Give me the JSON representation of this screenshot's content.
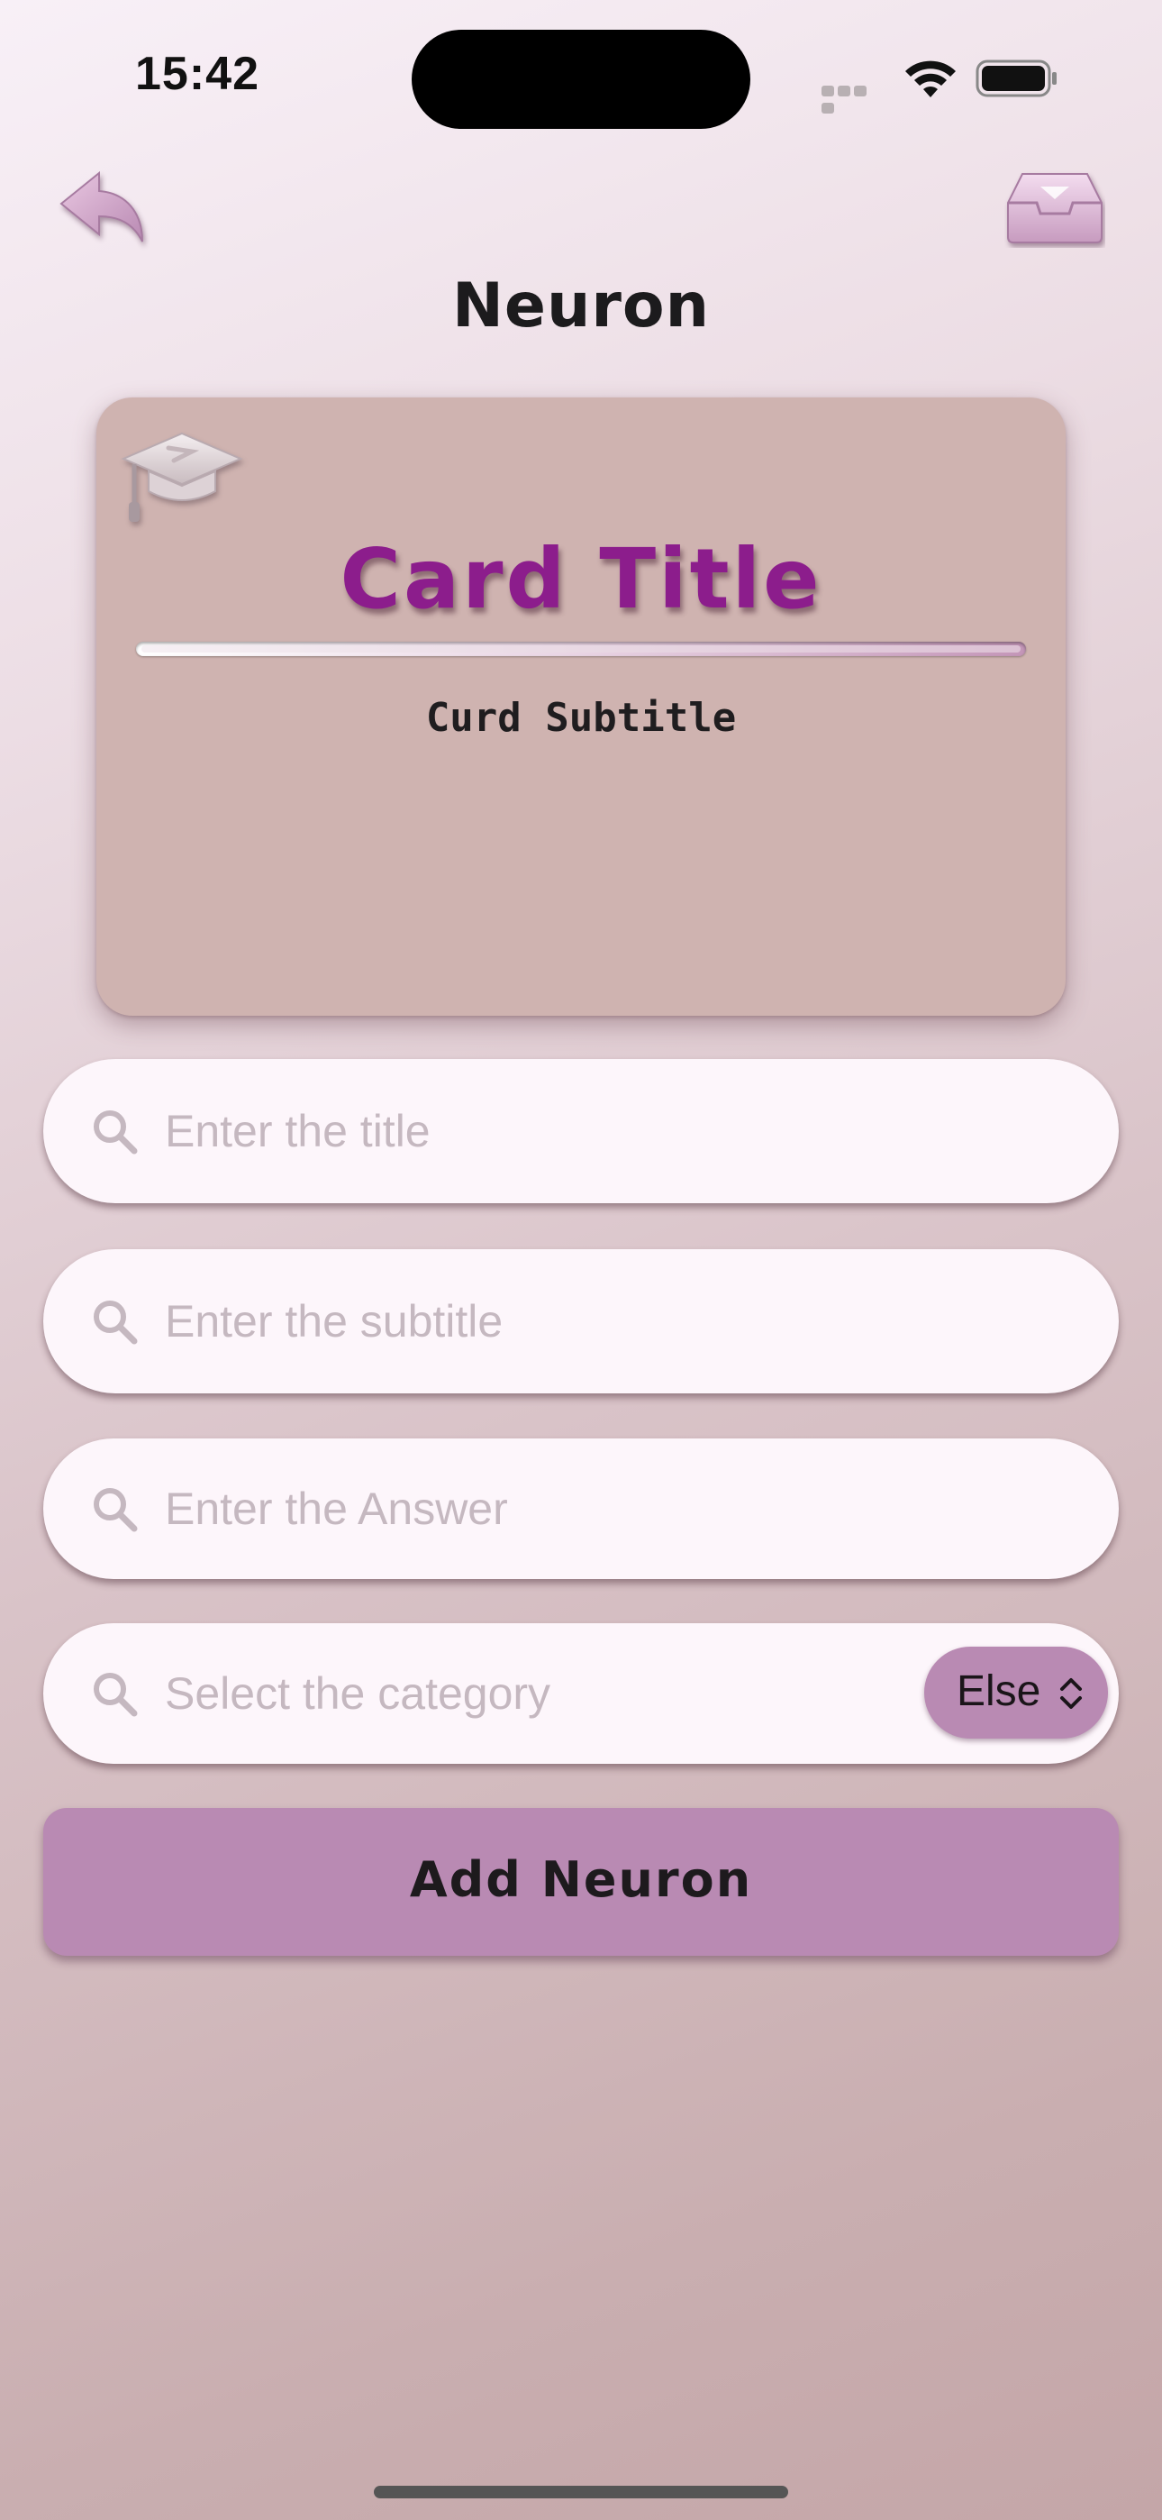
{
  "status_bar": {
    "time": "15:42"
  },
  "nav": {
    "back_icon": "arrow-uturn-back-icon",
    "tray_icon": "tray-icon",
    "title": "Neuron"
  },
  "preview_card": {
    "icon": "graduation-cap-icon",
    "title": "Card Title",
    "subtitle": "Curd Subtitle",
    "background_color": "#cfb3b0",
    "title_color": "#8c1d8c"
  },
  "form": {
    "title_field": {
      "placeholder": "Enter the title",
      "value": ""
    },
    "subtitle_field": {
      "placeholder": "Enter the subtitle",
      "value": ""
    },
    "answer_field": {
      "placeholder": "Enter the Answer",
      "value": ""
    },
    "category_field": {
      "placeholder": "Select the category",
      "value": "",
      "selected": "Else"
    },
    "submit_label": "Add Neuron",
    "accent_color": "#b98ab3"
  }
}
